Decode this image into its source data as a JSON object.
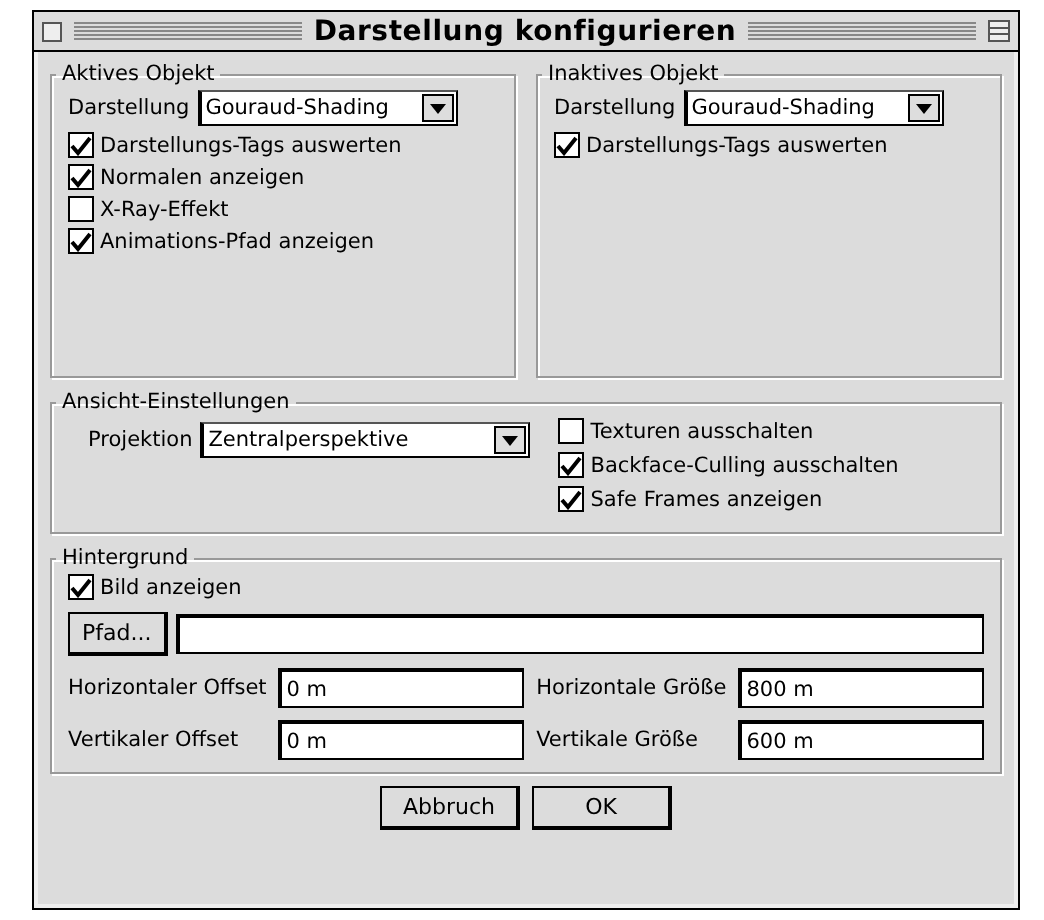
{
  "window": {
    "title": "Darstellung konfigurieren"
  },
  "active_object": {
    "title": "Aktives Objekt",
    "display": {
      "label": "Darstellung",
      "value": "Gouraud-Shading"
    },
    "options": [
      {
        "label": "Darstellungs-Tags auswerten",
        "checked": true
      },
      {
        "label": "Normalen anzeigen",
        "checked": true
      },
      {
        "label": "X-Ray-Effekt",
        "checked": false
      },
      {
        "label": "Animations-Pfad anzeigen",
        "checked": true
      }
    ]
  },
  "inactive_object": {
    "title": "Inaktives Objekt",
    "display": {
      "label": "Darstellung",
      "value": "Gouraud-Shading"
    },
    "options": [
      {
        "label": "Darstellungs-Tags auswerten",
        "checked": true
      }
    ]
  },
  "view_settings": {
    "title": "Ansicht-Einstellungen",
    "projection": {
      "label": "Projektion",
      "value": "Zentralperspektive"
    },
    "options": [
      {
        "label": "Texturen ausschalten",
        "checked": false
      },
      {
        "label": "Backface-Culling ausschalten",
        "checked": true
      },
      {
        "label": "Safe Frames anzeigen",
        "checked": true
      }
    ]
  },
  "background": {
    "title": "Hintergrund",
    "show_image": {
      "label": "Bild anzeigen",
      "checked": true
    },
    "path_button": "Pfad...",
    "fields": [
      {
        "label": "Horizontaler Offset",
        "value": "0 m"
      },
      {
        "label": "Horizontale Größe",
        "value": "800 m"
      },
      {
        "label": "Vertikaler Offset",
        "value": "0 m"
      },
      {
        "label": "Vertikale Größe",
        "value": "600 m"
      }
    ]
  },
  "buttons": [
    "Abbruch",
    "OK"
  ]
}
